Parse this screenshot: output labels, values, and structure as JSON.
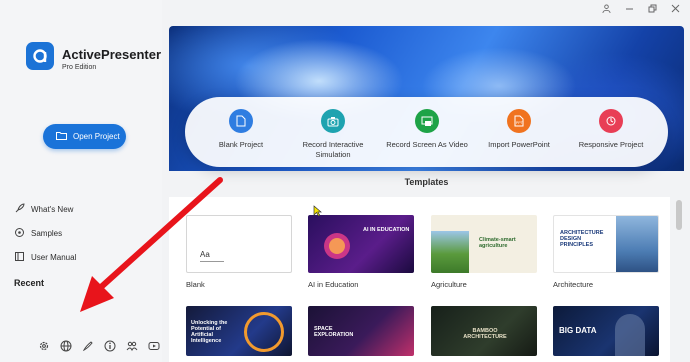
{
  "app": {
    "name": "ActivePresenter",
    "edition": "Pro Edition"
  },
  "sidebar": {
    "open_button": "Open Project",
    "links": [
      {
        "label": "What's New",
        "icon": "rocket-icon"
      },
      {
        "label": "Samples",
        "icon": "samples-icon"
      },
      {
        "label": "User Manual",
        "icon": "book-icon"
      }
    ],
    "recent_heading": "Recent",
    "footer_icons": [
      "gear-icon",
      "globe-icon",
      "theme-icon",
      "info-icon",
      "community-icon",
      "youtube-icon"
    ]
  },
  "actions": [
    {
      "label": "Blank Project",
      "color": "#2f7de1"
    },
    {
      "label": "Record Interactive Simulation",
      "color": "#1ea3b0"
    },
    {
      "label": "Record Screen As Video",
      "color": "#1ea347"
    },
    {
      "label": "Import PowerPoint",
      "color": "#f0731f"
    },
    {
      "label": "Responsive Project",
      "color": "#e83e55"
    }
  ],
  "templates": {
    "heading": "Templates",
    "items": [
      {
        "label": "Blank",
        "thumb_text": "Aa"
      },
      {
        "label": "AI in Education",
        "thumb_text": "AI IN EDUCATION"
      },
      {
        "label": "Agriculture",
        "thumb_text": "Climate-smart agriculture"
      },
      {
        "label": "Architecture",
        "thumb_text": "ARCHITECTURE DESIGN PRINCIPLES"
      },
      {
        "label": "",
        "thumb_text": "Unlocking the Potential of Artificial Intelligence"
      },
      {
        "label": "",
        "thumb_text": "SPACE EXPLORATION"
      },
      {
        "label": "",
        "thumb_text": "BAMBOO ARCHITECTURE"
      },
      {
        "label": "",
        "thumb_text": "BIG DATA"
      }
    ]
  },
  "colors": {
    "accent": "#1a73d9",
    "annotation_arrow": "#e8141b"
  }
}
